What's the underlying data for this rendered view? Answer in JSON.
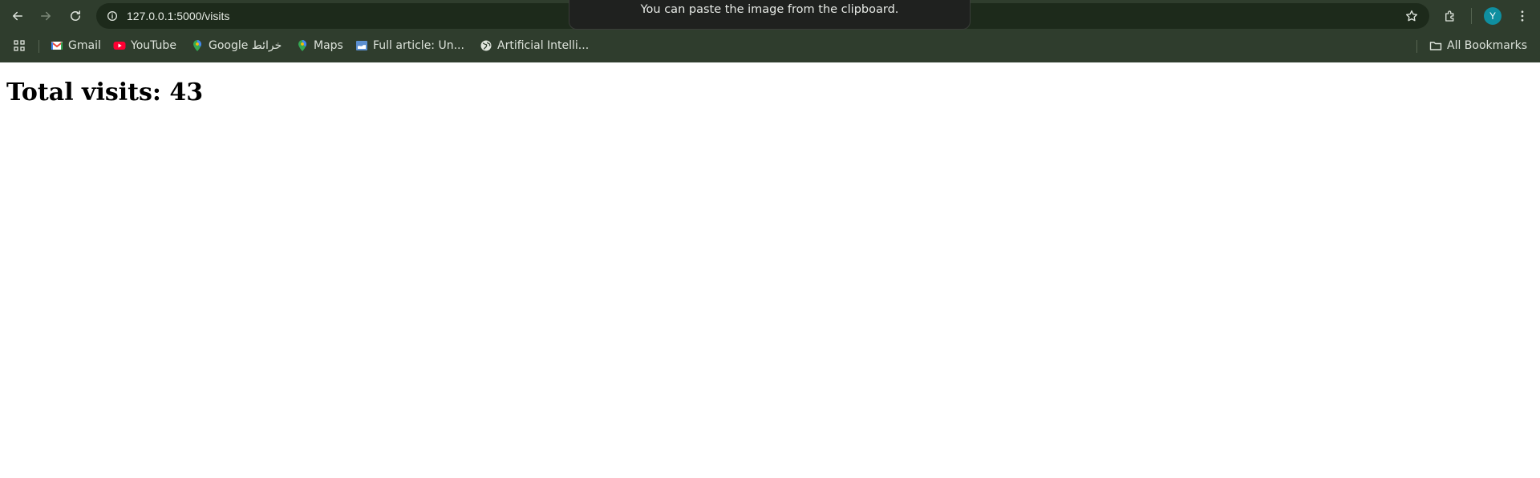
{
  "browser": {
    "url": "127.0.0.1:5000/visits",
    "tooltip": "You can paste the image from the clipboard.",
    "profile_initial": "Y"
  },
  "bookmarks": {
    "items": [
      {
        "label": "Gmail",
        "icon": "gmail-icon"
      },
      {
        "label": "YouTube",
        "icon": "youtube-icon"
      },
      {
        "label": "Google خرائط",
        "icon": "maps-pin-icon"
      },
      {
        "label": "Maps",
        "icon": "maps-pin-icon"
      },
      {
        "label": "Full article: Un...",
        "icon": "article-icon"
      },
      {
        "label": "Artificial Intelli...",
        "icon": "globe-icon"
      }
    ],
    "all_bookmarks": "All Bookmarks"
  },
  "page": {
    "heading": "Total visits: 43"
  },
  "colors": {
    "chrome": "#2f3d2d",
    "omnibox": "#1d2a1b",
    "avatar": "#0f8fa0"
  }
}
